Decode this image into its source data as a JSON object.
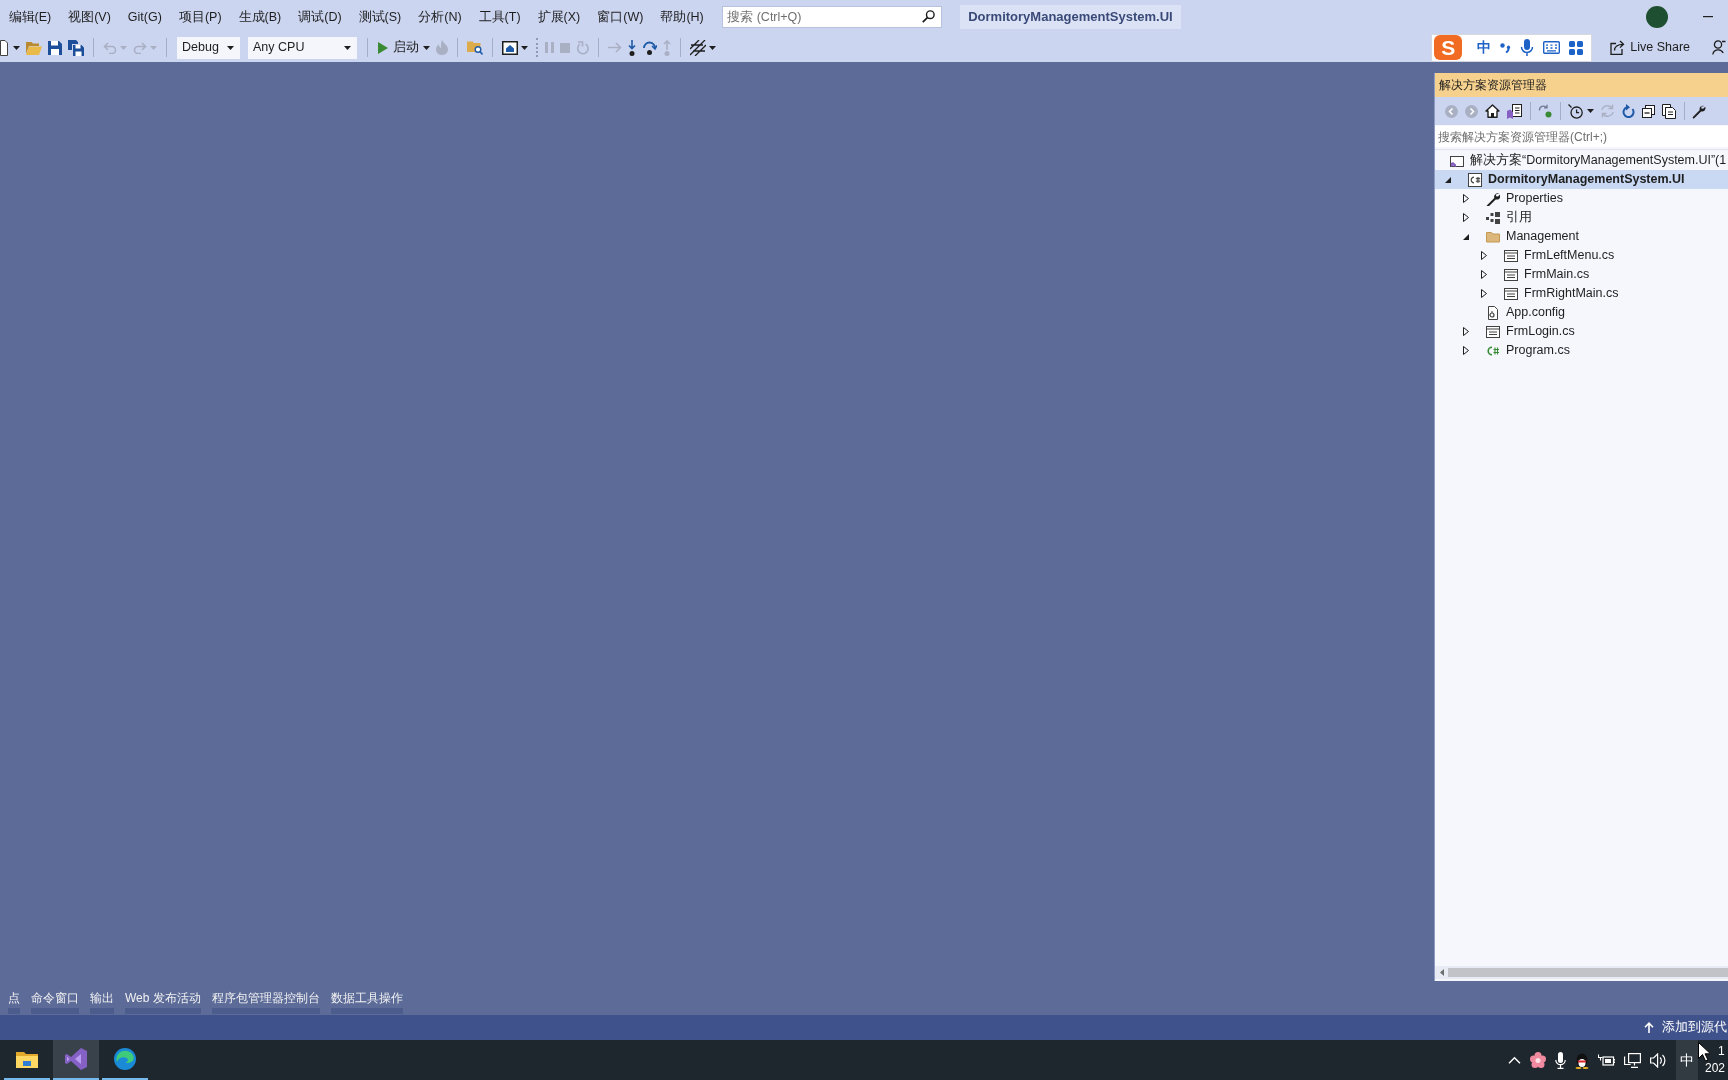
{
  "menu_bar": {
    "items": [
      "编辑(E)",
      "视图(V)",
      "Git(G)",
      "项目(P)",
      "生成(B)",
      "调试(D)",
      "测试(S)",
      "分析(N)",
      "工具(T)",
      "扩展(X)",
      "窗口(W)",
      "帮助(H)"
    ],
    "search": {
      "placeholder": "搜索 (Ctrl+Q)"
    },
    "solution_name": "DormitoryManagementSystem.UI"
  },
  "toolbar": {
    "groups": [
      {
        "items": [
          {
            "kind": "icon",
            "disabled": false,
            "menu": true
          },
          {
            "kind": "icon",
            "disabled": false
          },
          {
            "kind": "icon",
            "disabled": false
          },
          {
            "kind": "icon",
            "disabled": false
          }
        ]
      },
      {
        "items": [
          {
            "kind": "icon",
            "disabled": true,
            "menu": true
          },
          {
            "kind": "icon",
            "disabled": true,
            "menu": true
          }
        ]
      },
      {
        "items": [
          {
            "kind": "select",
            "value": "Debug"
          },
          {
            "kind": "select",
            "value": "Any CPU"
          }
        ]
      },
      {
        "items": [
          {
            "kind": "run",
            "label": "启动",
            "menu": true
          },
          {
            "kind": "icon",
            "disabled": true
          }
        ]
      },
      {
        "items": [
          {
            "kind": "icon",
            "disabled": false
          }
        ]
      },
      {
        "items": [
          {
            "kind": "icon",
            "disabled": false,
            "menu": true
          }
        ]
      },
      {
        "grip": true,
        "items": [
          {
            "kind": "icon",
            "disabled": true
          },
          {
            "kind": "icon",
            "disabled": true
          },
          {
            "kind": "icon",
            "disabled": true
          }
        ]
      },
      {
        "items": [
          {
            "kind": "icon",
            "disabled": true
          },
          {
            "kind": "icon",
            "disabled": false
          },
          {
            "kind": "icon",
            "disabled": false
          },
          {
            "kind": "icon",
            "disabled": true
          }
        ]
      },
      {
        "items": [
          {
            "kind": "icon",
            "disabled": false,
            "menu": true
          }
        ]
      }
    ]
  },
  "ime_bar": {
    "logo": "S",
    "mode": "中"
  },
  "live_share": {
    "label": "Live Share"
  },
  "solution_explorer": {
    "title": "解决方案资源管理器",
    "toolbar": [
      {
        "disabled": true
      },
      {
        "disabled": true
      },
      {
        "disabled": false
      },
      {
        "disabled": false
      },
      {
        "disabled": false
      },
      {
        "disabled": false,
        "menu": true
      },
      {
        "disabled": true
      },
      {
        "disabled": false
      },
      {
        "disabled": false
      },
      {
        "disabled": false
      },
      {
        "disabled": false
      }
    ],
    "search": {
      "placeholder": "搜索解决方案资源管理器(Ctrl+;)"
    },
    "tree": [
      {
        "kind": "solution",
        "label": "解决方案“DormitoryManagementSystem.UI”(1",
        "selected": false,
        "children": [
          {
            "kind": "project",
            "label": "DormitoryManagementSystem.UI",
            "selected": true,
            "expanded": true,
            "children": [
              {
                "kind": "properties",
                "label": "Properties",
                "selected": false,
                "expanded": false
              },
              {
                "kind": "references",
                "label": "引用",
                "selected": false,
                "expanded": false
              },
              {
                "kind": "folder",
                "label": "Management",
                "selected": false,
                "expanded": true,
                "children": [
                  {
                    "kind": "form",
                    "label": "FrmLeftMenu.cs",
                    "selected": false,
                    "expanded": false
                  },
                  {
                    "kind": "form",
                    "label": "FrmMain.cs",
                    "selected": false,
                    "expanded": false
                  },
                  {
                    "kind": "form",
                    "label": "FrmRightMain.cs",
                    "selected": false,
                    "expanded": false
                  }
                ]
              },
              {
                "kind": "config",
                "label": "App.config",
                "selected": false
              },
              {
                "kind": "form",
                "label": "FrmLogin.cs",
                "selected": false,
                "expanded": false
              },
              {
                "kind": "code",
                "label": "Program.cs",
                "selected": false,
                "expanded": false
              }
            ]
          }
        ]
      }
    ]
  },
  "tool_tabs": [
    {
      "label": "点",
      "selected": false
    },
    {
      "label": "命令窗口",
      "selected": false
    },
    {
      "label": "输出",
      "selected": false
    },
    {
      "label": "Web 发布活动",
      "selected": false
    },
    {
      "label": "程序包管理器控制台",
      "selected": false
    },
    {
      "label": "数据工具操作",
      "selected": false
    }
  ],
  "status_bar": {
    "text": "添加到源代"
  },
  "taskbar": {
    "apps": [
      {
        "selected": false
      },
      {
        "selected": true
      },
      {
        "selected": false
      }
    ],
    "ime": "中",
    "clock": {
      "time": "1",
      "date": "202"
    }
  }
}
